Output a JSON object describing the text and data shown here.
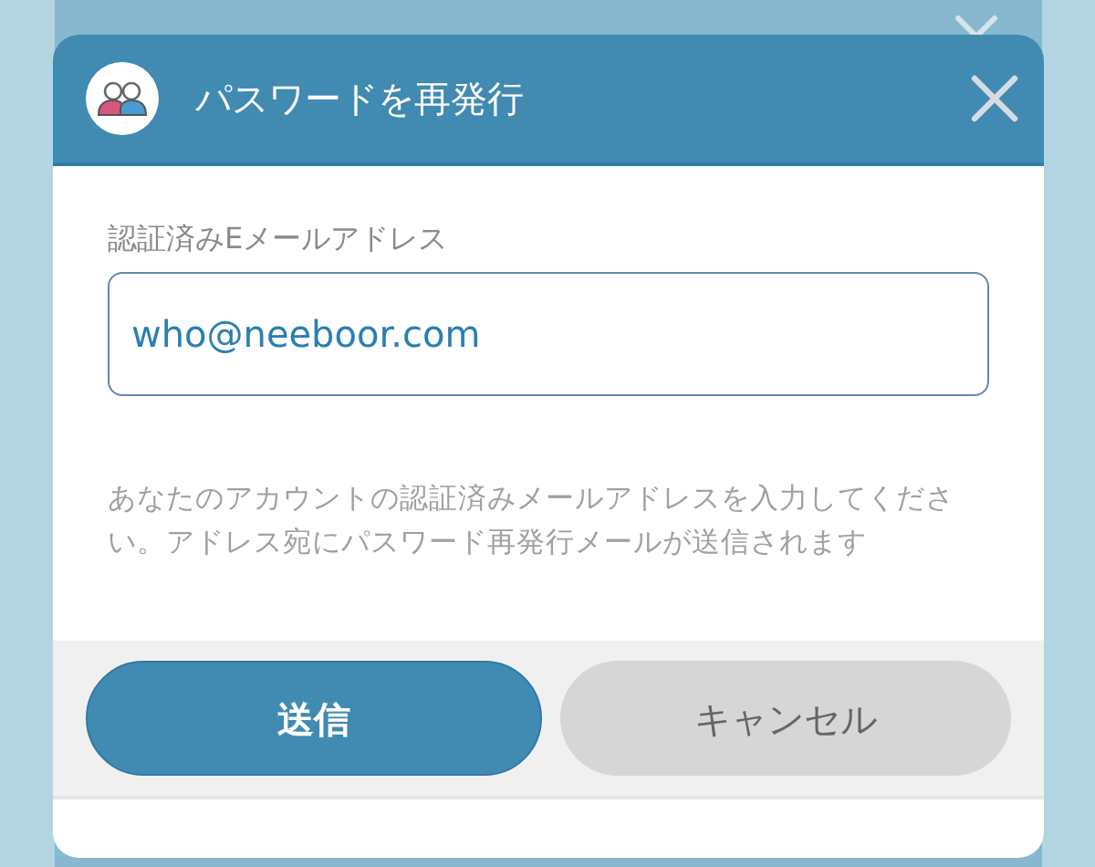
{
  "dialog": {
    "title": "パスワードを再発行",
    "field": {
      "label": "認証済みEメールアドレス",
      "value": "who@neeboor.com"
    },
    "help": "あなたのアカウントの認証済みメールアドレスを入力してください。アドレス宛にパスワード再発行メールが送信されます",
    "buttons": [
      {
        "label": "送信",
        "kind": "primary"
      },
      {
        "label": "キャンセル",
        "kind": "secondary"
      }
    ]
  }
}
